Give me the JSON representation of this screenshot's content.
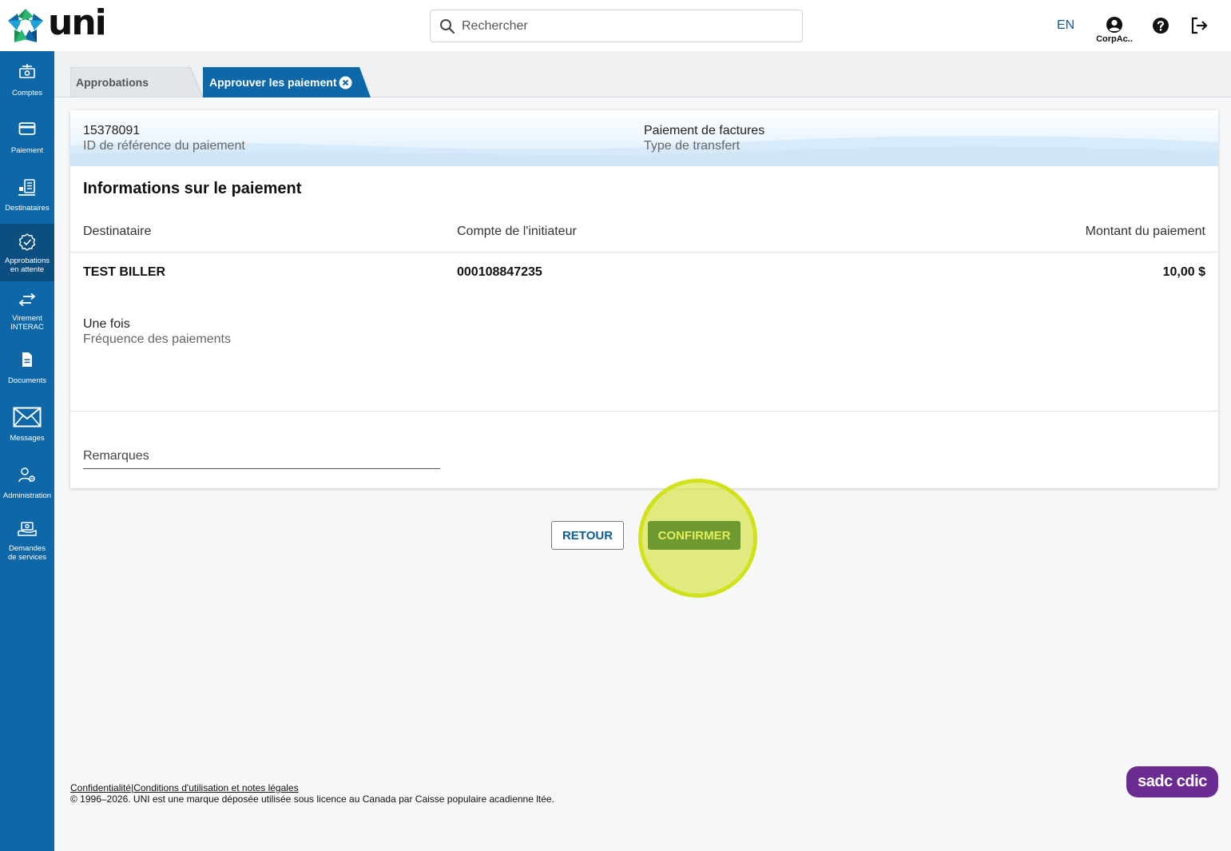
{
  "brand": {
    "name": "uni",
    "colors": {
      "primary": "#0e67a7",
      "primary_dark": "#0b4f80",
      "confirm": "#6f9a31",
      "highlight": "#d2e21a",
      "cdic": "#6b2c91"
    }
  },
  "header": {
    "search_placeholder": "Rechercher",
    "lang": "EN",
    "user_name": "CorpAc..",
    "icons": {
      "search": "search-icon",
      "user": "user-circle-icon",
      "help": "help-circle-icon",
      "logout": "logout-icon"
    }
  },
  "sidebar": {
    "items": [
      {
        "line1": "Comptes",
        "line2": "",
        "icon": "accounts-icon"
      },
      {
        "line1": "Paiement",
        "line2": "",
        "icon": "credit-card-icon"
      },
      {
        "line1": "Destinataires",
        "line2": "",
        "icon": "payees-icon"
      },
      {
        "line1": "Approbations",
        "line2": "en attente",
        "icon": "approval-badge-icon"
      },
      {
        "line1": "Virement",
        "line2": "INTERAC",
        "icon": "transfer-arrows-icon"
      },
      {
        "line1": "Documents",
        "line2": "",
        "icon": "document-icon"
      },
      {
        "line1": "Messages",
        "line2": "",
        "icon": "envelope-icon"
      },
      {
        "line1": "Administration",
        "line2": "",
        "icon": "user-gear-icon"
      },
      {
        "line1": "Demandes",
        "line2": "de services",
        "icon": "service-request-icon"
      }
    ]
  },
  "tabs": {
    "tab1": "Approbations",
    "tab2": "Approuver les paiement"
  },
  "payment": {
    "reference_id": "15378091",
    "reference_label": "ID de référence du paiement",
    "transfer_type": "Paiement de factures",
    "transfer_type_label": "Type de transfert",
    "section_title": "Informations sur le paiement",
    "columns": {
      "recipient": "Destinataire",
      "account": "Compte de l'initiateur",
      "amount": "Montant du paiement"
    },
    "row": {
      "recipient": "TEST BILLER",
      "account": "000108847235",
      "amount": "10,00 $"
    },
    "frequency": "Une fois",
    "frequency_label": "Fréquence des paiements",
    "remarks_label": "Remarques"
  },
  "actions": {
    "back": "RETOUR",
    "confirm": "CONFIRMER"
  },
  "footer": {
    "privacy": "Confidentialité",
    "separator": "|",
    "terms": "Conditions d'utilisation et notes légales",
    "copyright": "© 1996–2026. UNI est une marque déposée utilisée sous licence au Canada par Caisse populaire acadienne ltée.",
    "cdic_badge": "sadc cdic"
  }
}
